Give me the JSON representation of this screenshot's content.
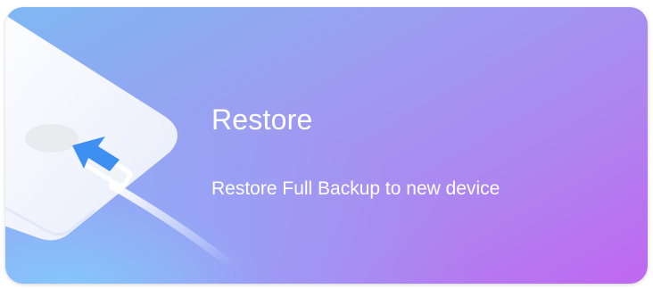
{
  "restore_card": {
    "title": "Restore",
    "subtitle": "Restore Full Backup to new device",
    "icons": {
      "device": "phone-device-icon",
      "arrow": "restore-arrow-icon",
      "cable": "usb-cable-icon"
    },
    "colors": {
      "gradient_start": "#7fb8f3",
      "gradient_mid": "#ad86f0",
      "gradient_end": "#c067f0",
      "text": "#ffffff",
      "arrow": "#3d8ff2"
    }
  }
}
